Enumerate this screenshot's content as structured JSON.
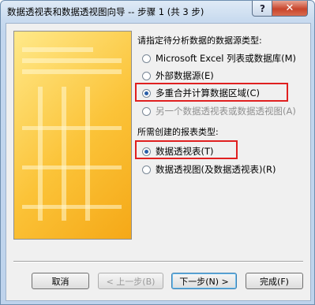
{
  "window": {
    "title": "数据透视表和数据透视图向导 -- 步骤 1 (共 3 步)",
    "help_label": "?",
    "close_label": "✕"
  },
  "data_source": {
    "heading": "请指定待分析数据的数据源类型:",
    "options": [
      {
        "label": "Microsoft Excel 列表或数据库(M)",
        "selected": false,
        "enabled": true
      },
      {
        "label": "外部数据源(E)",
        "selected": false,
        "enabled": true
      },
      {
        "label": "多重合并计算数据区域(C)",
        "selected": true,
        "enabled": true
      },
      {
        "label": "另一个数据透视表或数据透视图(A)",
        "selected": false,
        "enabled": false
      }
    ]
  },
  "report_type": {
    "heading": "所需创建的报表类型:",
    "options": [
      {
        "label": "数据透视表(T)",
        "selected": true,
        "enabled": true
      },
      {
        "label": "数据透视图(及数据透视表)(R)",
        "selected": false,
        "enabled": true
      }
    ]
  },
  "buttons": {
    "cancel": "取消",
    "back": "< 上一步(B)",
    "next": "下一步(N) >",
    "finish": "完成(F)"
  },
  "colors": {
    "highlight": "#e02020",
    "title_bar": "#c9dbef"
  }
}
